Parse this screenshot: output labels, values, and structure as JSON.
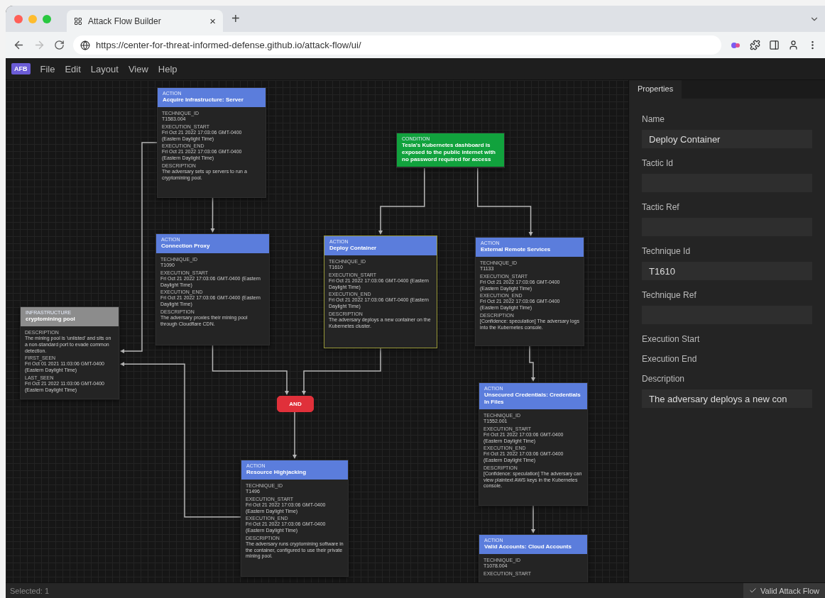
{
  "browser": {
    "tab_title": "Attack Flow Builder",
    "tab_close": "×",
    "new_tab": "+",
    "url": "https://center-for-threat-informed-defense.github.io/attack-flow/ui/"
  },
  "menu": {
    "logo": "AFB",
    "items": [
      "File",
      "Edit",
      "Layout",
      "View",
      "Help"
    ]
  },
  "canvas": {
    "nodes": [
      {
        "kind": "action",
        "type_label": "ACTION",
        "title": "Acquire Infrastructure: Server",
        "selected": false,
        "fields": [
          {
            "key": "TECHNIQUE_ID",
            "value": "T1583.004"
          },
          {
            "key": "EXECUTION_START",
            "value": "Fri Oct 21 2022 17:03:06 GMT-0400 (Eastern Daylight Time)"
          },
          {
            "key": "EXECUTION_END",
            "value": "Fri Oct 21 2022 17:03:06 GMT-0400 (Eastern Daylight Time)"
          },
          {
            "key": "DESCRIPTION",
            "value": "The adversary sets up servers to run a cryptomining pool."
          }
        ]
      },
      {
        "kind": "action",
        "type_label": "ACTION",
        "title": "Connection Proxy",
        "selected": false,
        "fields": [
          {
            "key": "TECHNIQUE_ID",
            "value": "T1090"
          },
          {
            "key": "EXECUTION_START",
            "value": "Fri Oct 21 2022 17:03:06 GMT-0400 (Eastern Daylight Time)"
          },
          {
            "key": "EXECUTION_END",
            "value": "Fri Oct 21 2022 17:03:06 GMT-0400 (Eastern Daylight Time)"
          },
          {
            "key": "DESCRIPTION",
            "value": "The adversary proxies their mining pool through Cloudflare CDN."
          }
        ]
      },
      {
        "kind": "condition",
        "type_label": "CONDITION",
        "title": "Tesla's Kubernetes dashboard is exposed to the public internet with no password required for access",
        "selected": false
      },
      {
        "kind": "action",
        "type_label": "ACTION",
        "title": "Deploy Container",
        "selected": true,
        "fields": [
          {
            "key": "TECHNIQUE_ID",
            "value": "T1610"
          },
          {
            "key": "EXECUTION_START",
            "value": "Fri Oct 21 2022 17:03:06 GMT-0400 (Eastern Daylight Time)"
          },
          {
            "key": "EXECUTION_END",
            "value": "Fri Oct 21 2022 17:03:06 GMT-0400 (Eastern Daylight Time)"
          },
          {
            "key": "DESCRIPTION",
            "value": "The adversary deploys a new container on the Kubernetes cluster."
          }
        ]
      },
      {
        "kind": "action",
        "type_label": "ACTION",
        "title": "External Remote Services",
        "selected": false,
        "fields": [
          {
            "key": "TECHNIQUE_ID",
            "value": "T1133"
          },
          {
            "key": "EXECUTION_START",
            "value": "Fri Oct 21 2022 17:03:06 GMT-0400 (Eastern Daylight Time)"
          },
          {
            "key": "EXECUTION_END",
            "value": "Fri Oct 21 2022 17:03:06 GMT-0400 (Eastern Daylight Time)"
          },
          {
            "key": "DESCRIPTION",
            "value": "[Confidence: speculation] The adversary logs into the Kubernetes console."
          }
        ]
      },
      {
        "kind": "infrastructure",
        "type_label": "INFRASTRUCTURE",
        "title": "cryptomining pool",
        "selected": false,
        "fields": [
          {
            "key": "DESCRIPTION",
            "value": "The mining pool is 'unlisted' and sits on a non-standard port to evade common detection."
          },
          {
            "key": "FIRST_SEEN",
            "value": "Fri Oct 01 2021 11:03:06 GMT-0400 (Eastern Daylight Time)"
          },
          {
            "key": "LAST_SEEN",
            "value": "Fri Oct 21 2022 11:03:06 GMT-0400 (Eastern Daylight Time)"
          }
        ]
      },
      {
        "kind": "operator",
        "title": "AND",
        "selected": false
      },
      {
        "kind": "action",
        "type_label": "ACTION",
        "title": "Resource Highjacking",
        "selected": false,
        "fields": [
          {
            "key": "TECHNIQUE_ID",
            "value": "T1496"
          },
          {
            "key": "EXECUTION_START",
            "value": "Fri Oct 21 2022 17:03:06 GMT-0400 (Eastern Daylight Time)"
          },
          {
            "key": "EXECUTION_END",
            "value": "Fri Oct 21 2022 17:03:06 GMT-0400 (Eastern Daylight Time)"
          },
          {
            "key": "DESCRIPTION",
            "value": "The adversary runs cryptomining software in the container, configured to use their private mining pool."
          }
        ]
      },
      {
        "kind": "action",
        "type_label": "ACTION",
        "title": "Unsecured Credentials: Credentials In Files",
        "selected": false,
        "fields": [
          {
            "key": "TECHNIQUE_ID",
            "value": "T1552.001"
          },
          {
            "key": "EXECUTION_START",
            "value": "Fri Oct 21 2022 17:03:06 GMT-0400 (Eastern Daylight Time)"
          },
          {
            "key": "EXECUTION_END",
            "value": "Fri Oct 21 2022 17:03:06 GMT-0400 (Eastern Daylight Time)"
          },
          {
            "key": "DESCRIPTION",
            "value": "[Confidence: speculation] The adversary can view plaintext AWS keys in the Kubernetes console."
          }
        ]
      },
      {
        "kind": "action",
        "type_label": "ACTION",
        "title": "Valid Accounts: Cloud Accounts",
        "selected": false,
        "fields": [
          {
            "key": "TECHNIQUE_ID",
            "value": "T1078.004"
          },
          {
            "key": "EXECUTION_START"
          }
        ]
      }
    ]
  },
  "properties": {
    "tab": "Properties",
    "fields": [
      {
        "kind": "input",
        "label": "Name",
        "value": "Deploy Container"
      },
      {
        "kind": "input",
        "label": "Tactic Id"
      },
      {
        "kind": "input",
        "label": "Tactic Ref"
      },
      {
        "kind": "input",
        "label": "Technique Id",
        "value": "T1610"
      },
      {
        "kind": "input",
        "label": "Technique Ref"
      },
      {
        "kind": "label",
        "label": "Execution Start"
      },
      {
        "kind": "label",
        "label": "Execution End"
      },
      {
        "kind": "input",
        "label": "Description",
        "value": "The adversary deploys a new con"
      }
    ]
  },
  "status_bar": {
    "selected": "Selected: 1",
    "validity": "Valid Attack Flow",
    "valid": true
  }
}
